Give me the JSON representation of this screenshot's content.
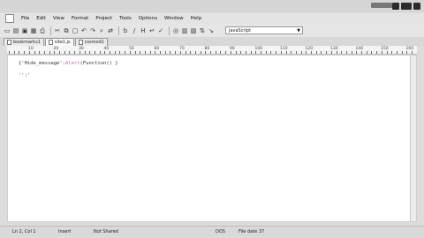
{
  "menu": {
    "items": [
      "File",
      "Edit",
      "View",
      "Format",
      "Project",
      "Tools",
      "Options",
      "Window",
      "Help"
    ]
  },
  "toolbar": {
    "icons": [
      "new-file-icon",
      "open-folder-icon",
      "save-icon",
      "save-all-icon",
      "print-icon",
      "cut-icon",
      "copy-icon",
      "paste-icon",
      "undo-icon",
      "redo-icon",
      "find-icon",
      "replace-icon",
      "bold-icon",
      "italic-icon",
      "hex-icon",
      "word-wrap-icon",
      "spellcheck-icon",
      "browser-icon",
      "column-icon",
      "macro-icon",
      "ftp-icon",
      "help-icon"
    ],
    "language_combo": "JavaScript"
  },
  "tabs": [
    {
      "label": "bookmarks1",
      "active": false
    },
    {
      "label": "site1.js",
      "active": true
    },
    {
      "label": "cssmod1",
      "active": false
    }
  ],
  "ruler": {
    "labels": [
      "10",
      "20",
      "30",
      "40",
      "50",
      "60",
      "70",
      "80",
      "90",
      "100",
      "110",
      "120",
      "130",
      "140",
      "150",
      "160"
    ]
  },
  "editor": {
    "lines": [
      {
        "pre": "{'Hide_message':",
        "fn": "Alert",
        "post": "(Function() }"
      },
      {
        "pre": "'':'",
        "fn": "",
        "post": ""
      }
    ]
  },
  "status": {
    "position": "Ln 2, Col 1",
    "mode": "Insert",
    "encoding": "Not Shared",
    "os": "DOS",
    "modified": "File date 37"
  }
}
